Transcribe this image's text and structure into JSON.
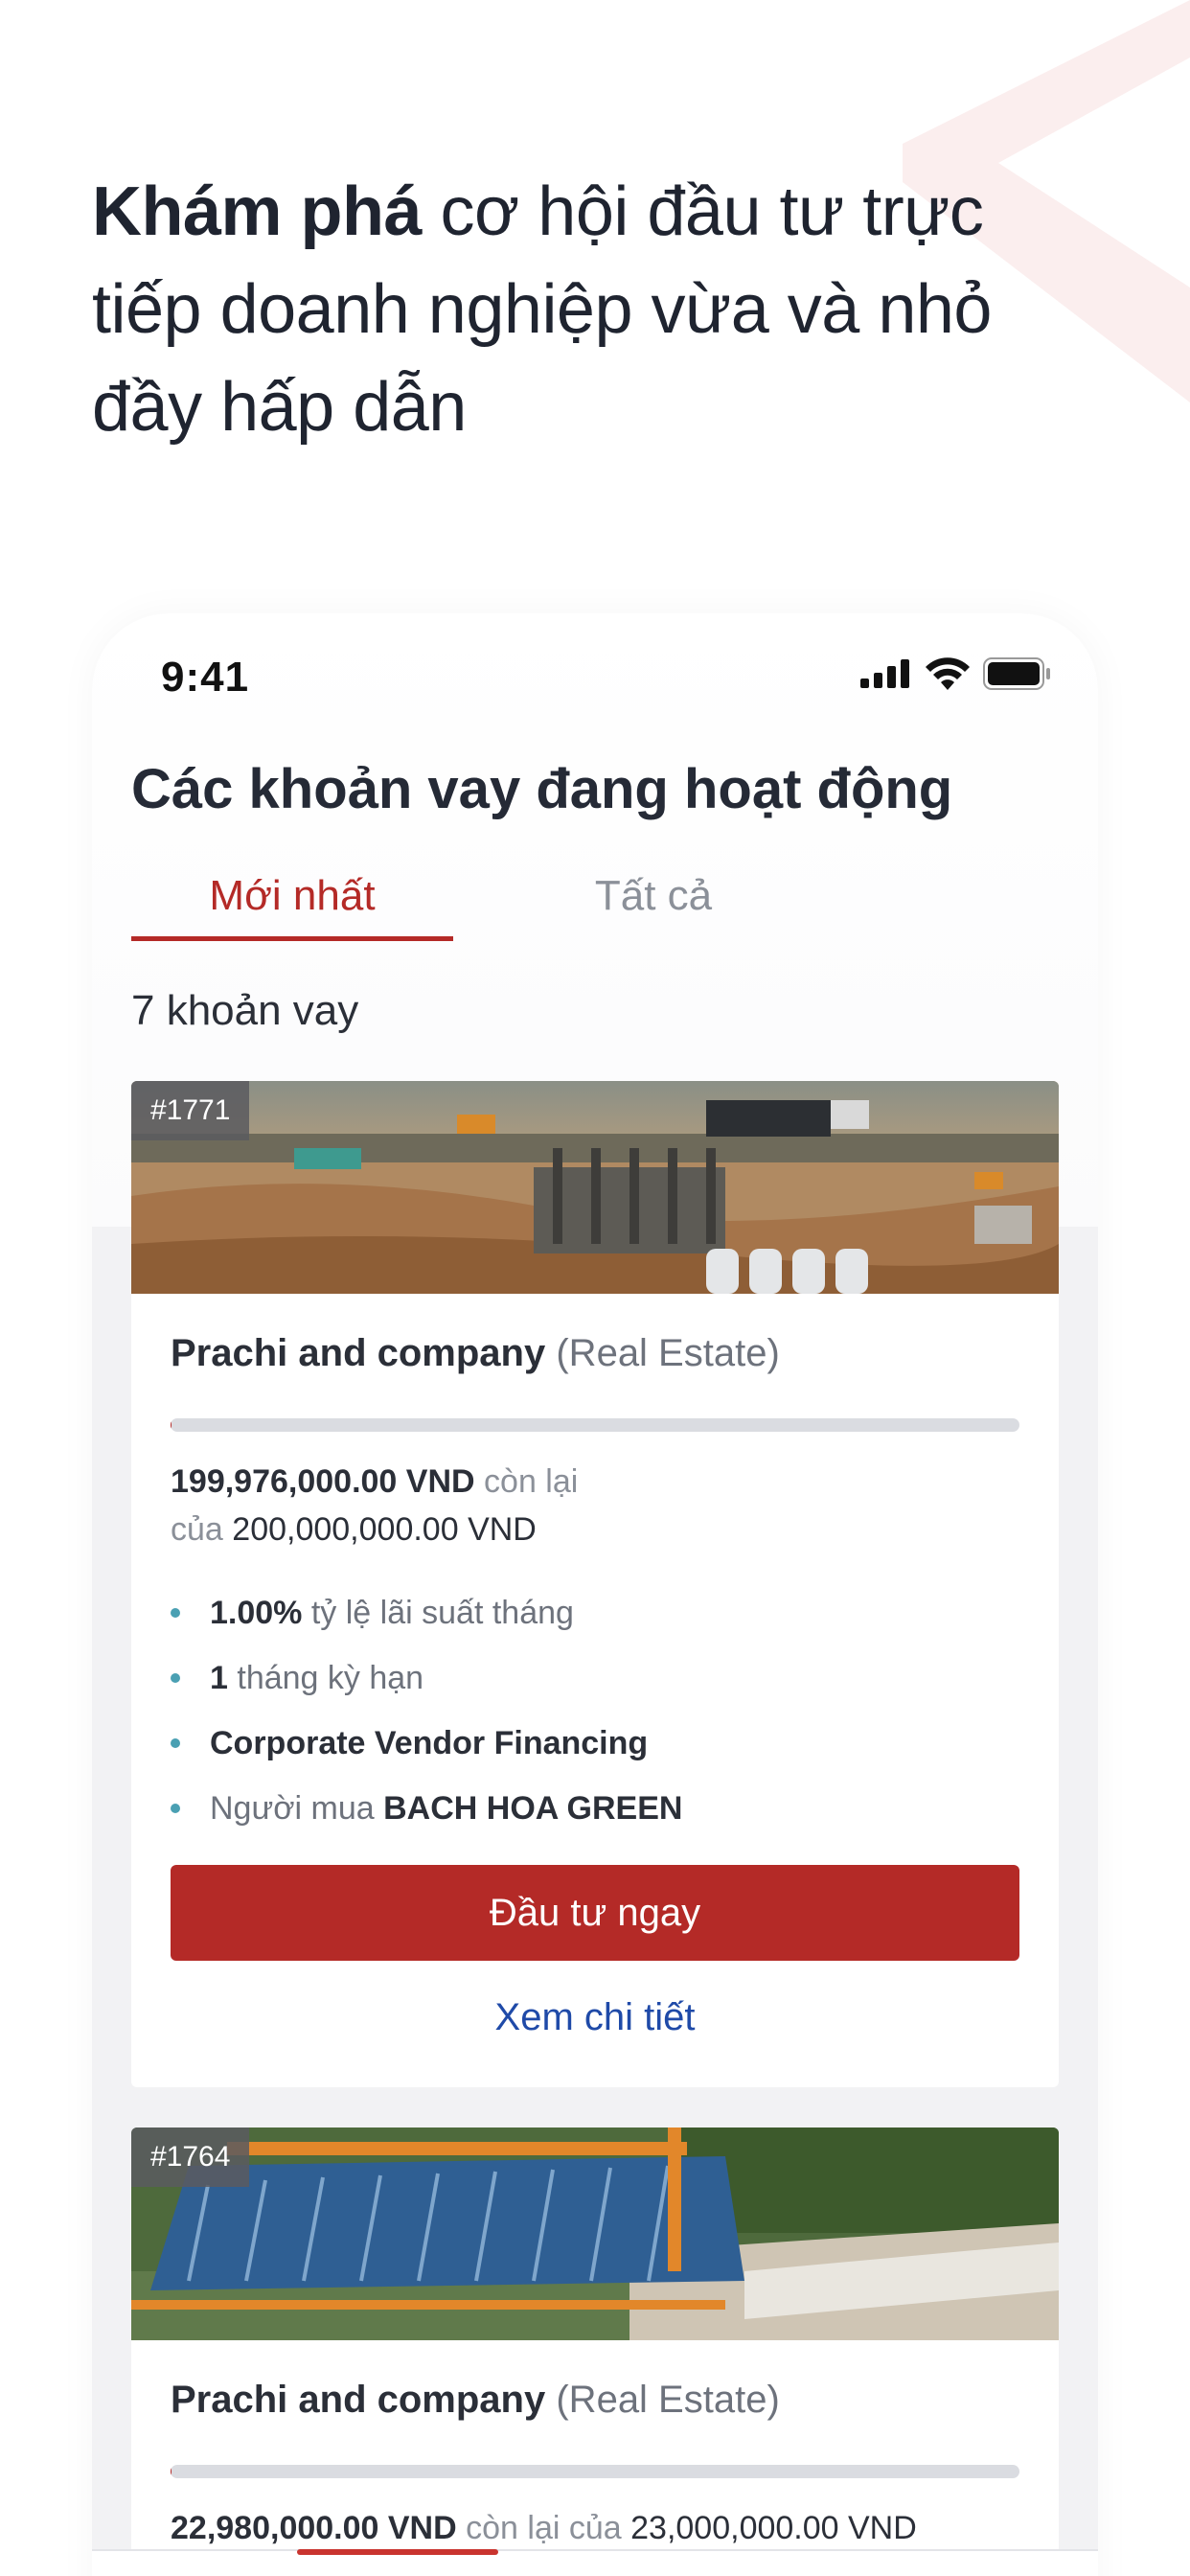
{
  "hero": {
    "headline_bold": "Khám phá",
    "headline_rest": " cơ hội đầu tư trực tiếp doanh nghiệp vừa và nhỏ đầy hấp dẫn"
  },
  "status_bar": {
    "time": "9:41"
  },
  "screen": {
    "title": "Các khoản vay đang hoạt động",
    "tabs": [
      {
        "label": "Mới nhất",
        "active": true
      },
      {
        "label": "Tất cả",
        "active": false
      }
    ],
    "loan_count": "7 khoản vay"
  },
  "loans": [
    {
      "id": "#1771",
      "image_icon": "construction-site-photo",
      "company": "Prachi and company",
      "industry": "(Real Estate)",
      "funded_fraction": 0.0001,
      "remaining": "199,976,000.00 VND",
      "remaining_suffix": "còn lại",
      "of_label": "của",
      "total": "200,000,000.00 VND",
      "interest_value": "1.00%",
      "interest_label": "tỷ lệ lãi suất tháng",
      "term_value": "1",
      "term_label": "tháng kỳ hạn",
      "product": "Corporate Vendor Financing",
      "buyer_label": "Người mua",
      "buyer": "BACH HOA GREEN",
      "invest_label": "Đầu tư ngay",
      "detail_label": "Xem chi tiết"
    },
    {
      "id": "#1764",
      "image_icon": "bridge-construction-photo",
      "company": "Prachi and company",
      "industry": "(Real Estate)",
      "funded_fraction": 0.001,
      "remaining": "22,980,000.00 VND",
      "remaining_suffix": "còn lại của",
      "total": "23,000,000.00 VND"
    }
  ],
  "colors": {
    "accent": "#b42a27",
    "link": "#1f4aa8",
    "bullet": "#4aa0b3"
  }
}
